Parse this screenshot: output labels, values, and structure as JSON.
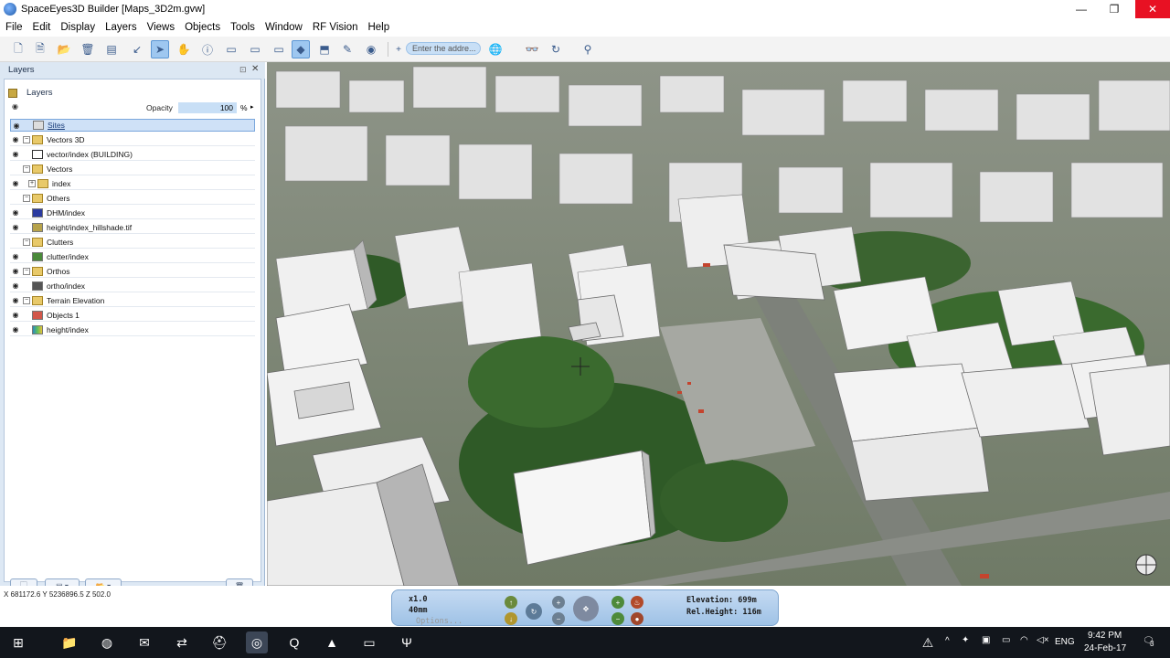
{
  "window": {
    "title": "SpaceEyes3D Builder [Maps_3D2m.gvw]",
    "min": "—",
    "max": "❐",
    "close": "✕"
  },
  "menu": [
    "File",
    "Edit",
    "Display",
    "Layers",
    "Views",
    "Objects",
    "Tools",
    "Window",
    "RF Vision",
    "Help"
  ],
  "toolbar": {
    "address_placeholder": "Enter the addre..."
  },
  "layers_panel": {
    "header": "Layers",
    "root": "Layers",
    "opacity_label": "Opacity",
    "opacity_value": "100",
    "opacity_unit": "%",
    "items": [
      {
        "label": "Sites",
        "selected": true,
        "icon": "sites-icon"
      },
      {
        "label": "Vectors 3D",
        "icon": "folder-icon"
      },
      {
        "label": "vector/index (BUILDING)",
        "icon": "vector-icon"
      },
      {
        "label": "Vectors",
        "icon": "folder-icon"
      },
      {
        "label": "index",
        "icon": "folder-icon"
      },
      {
        "label": "Others",
        "icon": "folder-icon"
      },
      {
        "label": "DHM/index",
        "icon": "raster-icon"
      },
      {
        "label": "height/index_hillshade.tif",
        "icon": "raster-icon"
      },
      {
        "label": "Clutters",
        "icon": "folder-icon"
      },
      {
        "label": "clutter/index",
        "icon": "raster-icon"
      },
      {
        "label": "Orthos",
        "icon": "folder-icon"
      },
      {
        "label": "ortho/index",
        "icon": "raster-icon"
      },
      {
        "label": "Terrain Elevation",
        "icon": "folder-icon"
      },
      {
        "label": "Objects 1",
        "icon": "objects-icon"
      },
      {
        "label": "height/index",
        "icon": "height-icon"
      }
    ]
  },
  "status": {
    "coords": "X 681172.6  Y 5236896.5  Z 502.0"
  },
  "navigation": {
    "speed": "x1.0",
    "focal": "40mm",
    "options": "Options...",
    "elevation": "Elevation:  699m",
    "rel_height": "Rel.Height:  116m"
  },
  "taskbar": {
    "language": "ENG",
    "time": "9:42 PM",
    "date": "24-Feb-17",
    "notifications": "3"
  }
}
